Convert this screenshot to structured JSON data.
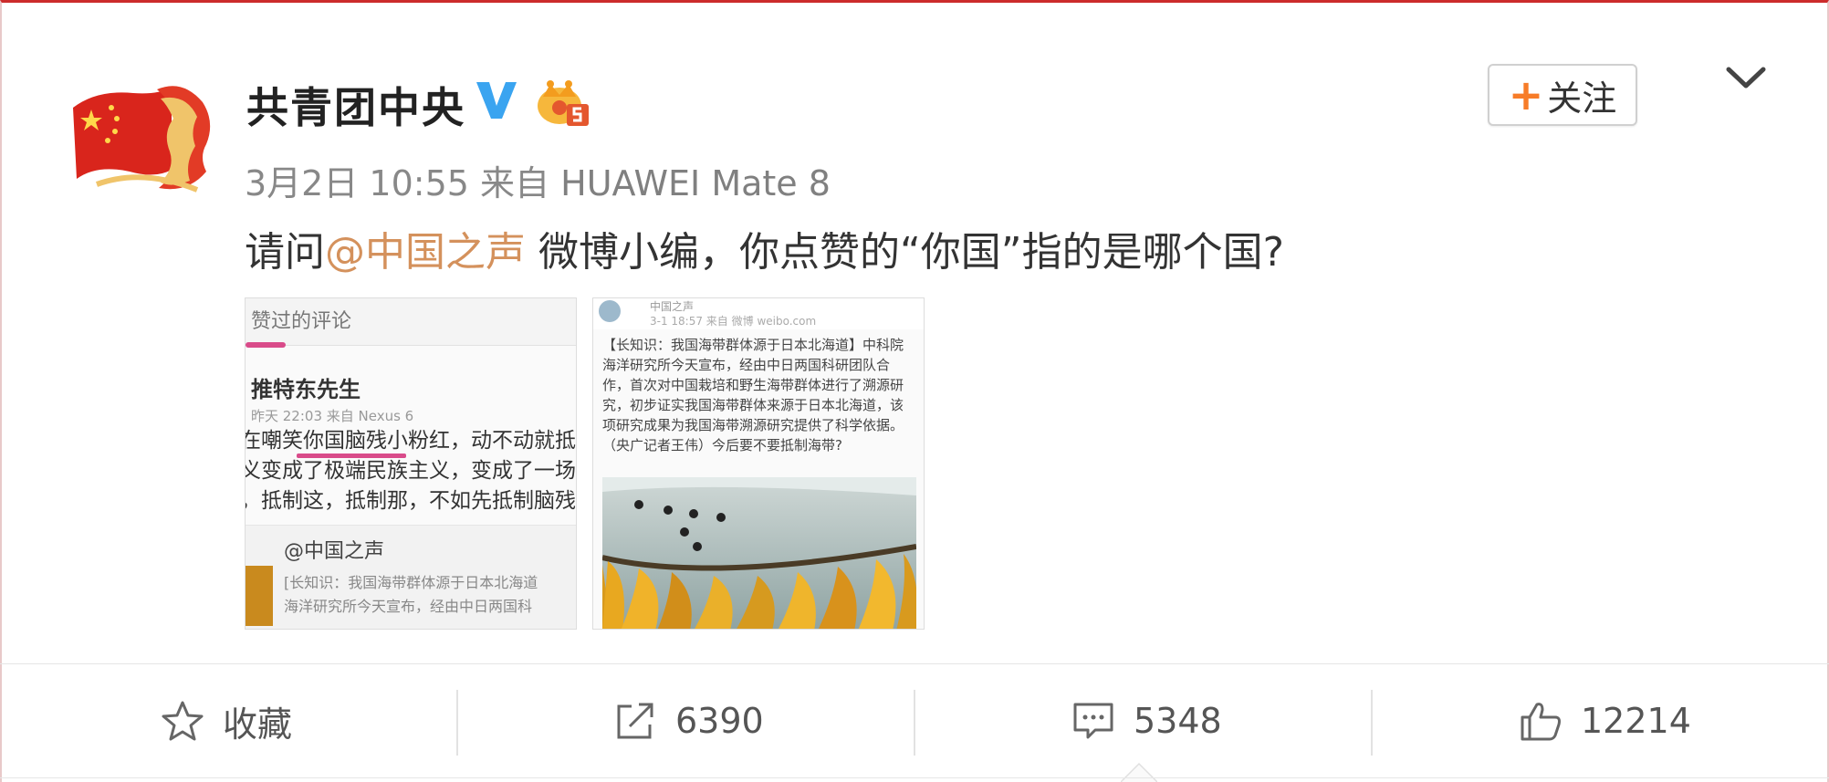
{
  "post": {
    "author_name": "共青团中央",
    "timestamp": "3月2日 10:55",
    "source_prefix": "来自",
    "source_device": "HUAWEI Mate 8",
    "text_before": "请问",
    "mention": "@中国之声",
    "text_after": " 微博小编，你点赞的“你国”指的是哪个国?",
    "follow_label": "关注",
    "follow_plus": "+"
  },
  "images": {
    "first": {
      "header": "赞过的评论",
      "user": "推特东先生",
      "time": "昨天 22:03  来自 Nexus 6",
      "lines": [
        "在嘲笑你国脑残小粉红，动不动就抵",
        "义变成了极端民族主义，变成了一场",
        "，抵制这，抵制那，不如先抵制脑残"
      ],
      "quote_name": "@中国之声",
      "quote_lines": [
        "[长知识：我国海带群体源于日本北海道",
        "海洋研究所今天宣布，经由中日两国科"
      ]
    },
    "second": {
      "headline": "中国之声",
      "sub": "3-1 18:57  来自 微博 weibo.com",
      "body": "【长知识：我国海带群体源于日本北海道】中科院海洋研究所今天宣布，经由中日两国科研团队合作，首次对中国栽培和野生海带群体进行了溯源研究，初步证实我国海带群体来源于日本北海道，该项研究成果为我国海带溯源研究提供了科学依据。（央广记者王伟）今后要不要抵制海带?"
    }
  },
  "actions": {
    "favorite_label": "收藏",
    "share_count": "6390",
    "comment_count": "5348",
    "like_count": "12214"
  },
  "icons": {
    "verified": "verified-v-icon",
    "crown": "vip-crown-icon",
    "chevron": "chevron-down-icon",
    "star": "star-icon",
    "share": "share-icon",
    "comment": "comment-icon",
    "like": "thumbs-up-icon"
  },
  "colors": {
    "mention": "#d4915c",
    "follow_plus": "#f77c28",
    "verified_blue": "#3aa4f0"
  }
}
